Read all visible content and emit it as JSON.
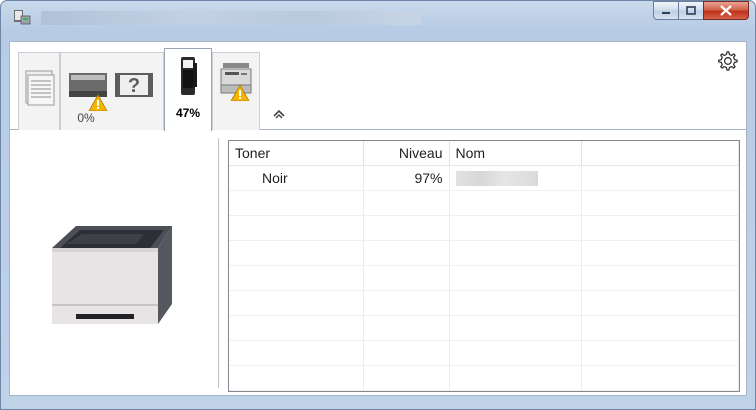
{
  "window": {
    "title": "",
    "app_icon": "printer-app-icon",
    "controls": {
      "minimize_icon": "minimize-icon",
      "maximize_icon": "maximize-icon",
      "close_icon": "close-icon"
    }
  },
  "tabs": [
    {
      "icon": "print-queue-icon",
      "label": ""
    },
    {
      "icon": "paper-tray-warning-icon",
      "label": "0%"
    },
    {
      "icon": "toner-cartridge-icon",
      "label": "47%"
    },
    {
      "icon": "printer-device-warning-icon",
      "label": ""
    }
  ],
  "toolbar": {
    "settings_icon": "gear-icon",
    "collapse_icon": "chevron-up-icon"
  },
  "preview": {
    "icon": "printer-preview-image"
  },
  "toner_table": {
    "columns": [
      "Toner",
      "Niveau",
      "Nom",
      ""
    ],
    "rows": [
      {
        "toner": "Noir",
        "level": "97%",
        "name": ""
      }
    ]
  },
  "colors": {
    "frame": "#bfd2e8",
    "close_button": "#c7432e",
    "warning": "#f5b400"
  }
}
